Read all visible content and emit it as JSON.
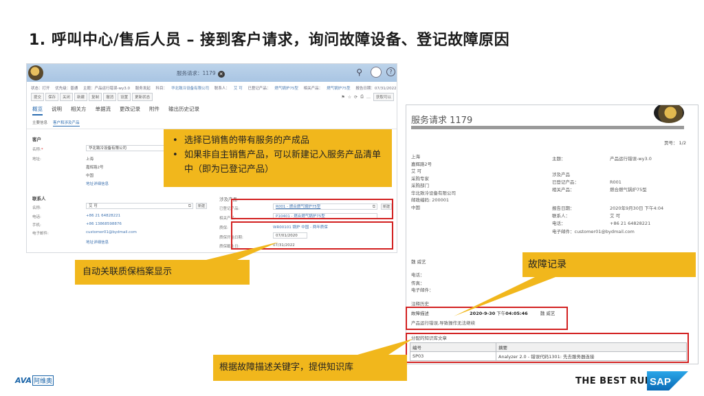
{
  "slide": {
    "title": "1. 呼叫中心/售后人员 – 接到客户请求，询问故障设备、登记故障原因"
  },
  "crm": {
    "title": "服务请求：1179",
    "close_glyph": "✕",
    "search_glyph": "⚲",
    "help_glyph": "?",
    "meta": {
      "status": "状态：打开",
      "priority": "优先级：普通",
      "subject": "主题：产品运行错误-wy3.0",
      "reporter": "服务发起",
      "account_label": "科目：",
      "account": "华北致冷设备有限公司",
      "contact_label": "联系人：",
      "contact": "艾 可",
      "product_label": "已登记产品：",
      "product": "燃气锅炉75型",
      "related_label": "相关产品：",
      "related": "燃气锅炉75型",
      "date": "报告日期：07/31/2022"
    },
    "toolbar": [
      "提交",
      "保存",
      "关闭",
      "新建",
      "复制",
      "撤消",
      "设置",
      "更新状态"
    ],
    "toolbar_right": [
      "⚑",
      "☆",
      "⟳",
      "⎙",
      "…",
      "获取可以"
    ],
    "tabs": [
      "概览",
      "说明",
      "相关方",
      "单据流",
      "更改记录",
      "附件",
      "输出历史记录"
    ],
    "subtabs": [
      "主要信息",
      "客户和涉及产品"
    ],
    "customer": {
      "section": "客户",
      "name_label": "名称:",
      "name_value": "华北致冷设备有限公司",
      "address_label": "地址:",
      "address_lines": [
        "上海",
        "嘉辉路2号",
        "中国"
      ],
      "address_link": "地址详细信息"
    },
    "contact": {
      "section": "联系人",
      "name_label": "名称:",
      "name_value": "艾 可",
      "new_btn": "新建",
      "phone_label": "电话:",
      "phone_value": "+86 21 64828221",
      "mobile_label": "手机:",
      "mobile_value": "+86 13868598876",
      "email_label": "电子邮件:",
      "email_value": "customer01@bydmail.com",
      "detail_link": "地址详细信息"
    },
    "products": {
      "section": "涉及产品",
      "registered_label": "已登记产品:",
      "registered_value": "R001 - 燃合燃气锅炉75型",
      "new_btn": "新建",
      "related_label": "相关产品:",
      "related_value": "P10401 - 燃合燃气锅炉75型",
      "warranty_label": "质保:",
      "warranty_value": "WR00101 锅炉 中国 - 两年质保",
      "start_label": "质保开始日期:",
      "start_value": "07/01/2020",
      "end_label": "质保截止日:",
      "end_value": "07/31/2022"
    }
  },
  "report": {
    "title": "服务请求 1179",
    "page": "页号：  1/2",
    "address_lines": [
      "上海",
      "嘉辉路2号",
      "艾 可",
      "采购专家",
      "采购部门",
      "华北致冷设备有限公司",
      "邮政编码: 200001",
      "中国"
    ],
    "subject_label": "主题：",
    "subject_value": "产品运行错误-wy3.0",
    "involved_label": "涉及产品",
    "registered_label": "已登记产品：",
    "registered_value": "R001",
    "related_label": "相关产品：",
    "related_value": "燃合燃气锅炉75型",
    "date_label": "报告日期：",
    "date_value": "2020年9月30日 下午4:04",
    "contact_label": "联系人：",
    "contact_value": "艾 可",
    "phone_label": "电话：",
    "phone_value": "+86 21 64828221",
    "email_label": "电子邮件：",
    "email_value": "customer01@bydmail.com",
    "agent": "魏 威艺",
    "agent_phone": "电话：",
    "agent_fax": "传真：",
    "agent_email": "电子邮件：",
    "notes_heading": "注释历史",
    "note_type": "故障描述",
    "note_date": "2020-9-30",
    "note_time_prefix": "下午",
    "note_time": "04:05:46",
    "note_author": "魏 威艺",
    "note_text": "产品运行错误,导致操作无法继续",
    "kb_heading": "分配的知识库文章",
    "kb_headers": [
      "编号",
      "摘要"
    ],
    "kb_rows": [
      [
        "SP03",
        "Analyzer 2.0 - 错误代码1301: 先去服务器连接"
      ]
    ]
  },
  "callouts": {
    "list": [
      "选择已销售的带有服务的产成品",
      "如果非自主销售产品，可以新建记入服务产品清单中（即为已登记产品）"
    ],
    "qa": "自动关联质保档案显示",
    "fault": "故障记录",
    "kb": "根据故障描述关键字，提供知识库"
  },
  "footer": {
    "ava": "AVA",
    "ava_cn": "阿维奥",
    "bestrun": "THE BEST RUN",
    "sap": "SAP"
  },
  "colors": {
    "callout": "#f1b71c",
    "highlight_box": "#d21f1f",
    "crm_header": "#a9c5e3",
    "link": "#3f73b0"
  }
}
